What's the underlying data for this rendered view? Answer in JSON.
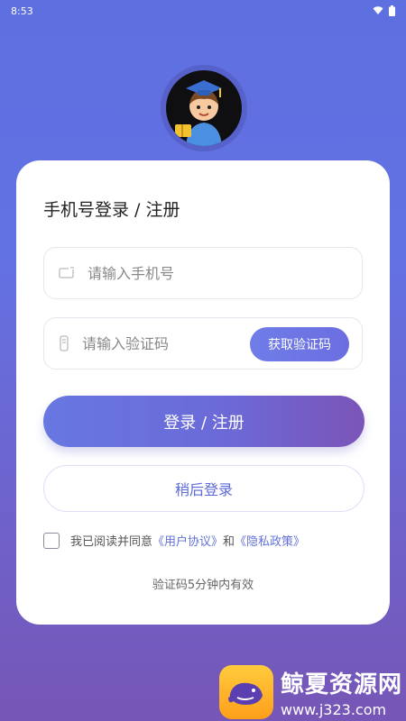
{
  "status_bar": {
    "time": "8:53"
  },
  "login": {
    "title": "手机号登录 / 注册",
    "phone_placeholder": "请输入手机号",
    "code_placeholder": "请输入验证码",
    "get_code_label": "获取验证码",
    "login_label": "登录 / 注册",
    "later_label": "稍后登录",
    "agree_prefix": "我已阅读并同意",
    "user_agreement": "《用户协议》",
    "and_text": "和",
    "privacy_policy": "《隐私政策》",
    "note": "验证码5分钟内有效",
    "agree_checked": false
  },
  "watermark": {
    "name": "鲸夏资源网",
    "url": "www.j323.com"
  },
  "colors": {
    "accent": "#6470e0",
    "link": "#6272d9",
    "background_top": "#5e6fe0",
    "background_bottom": "#7656b6"
  }
}
